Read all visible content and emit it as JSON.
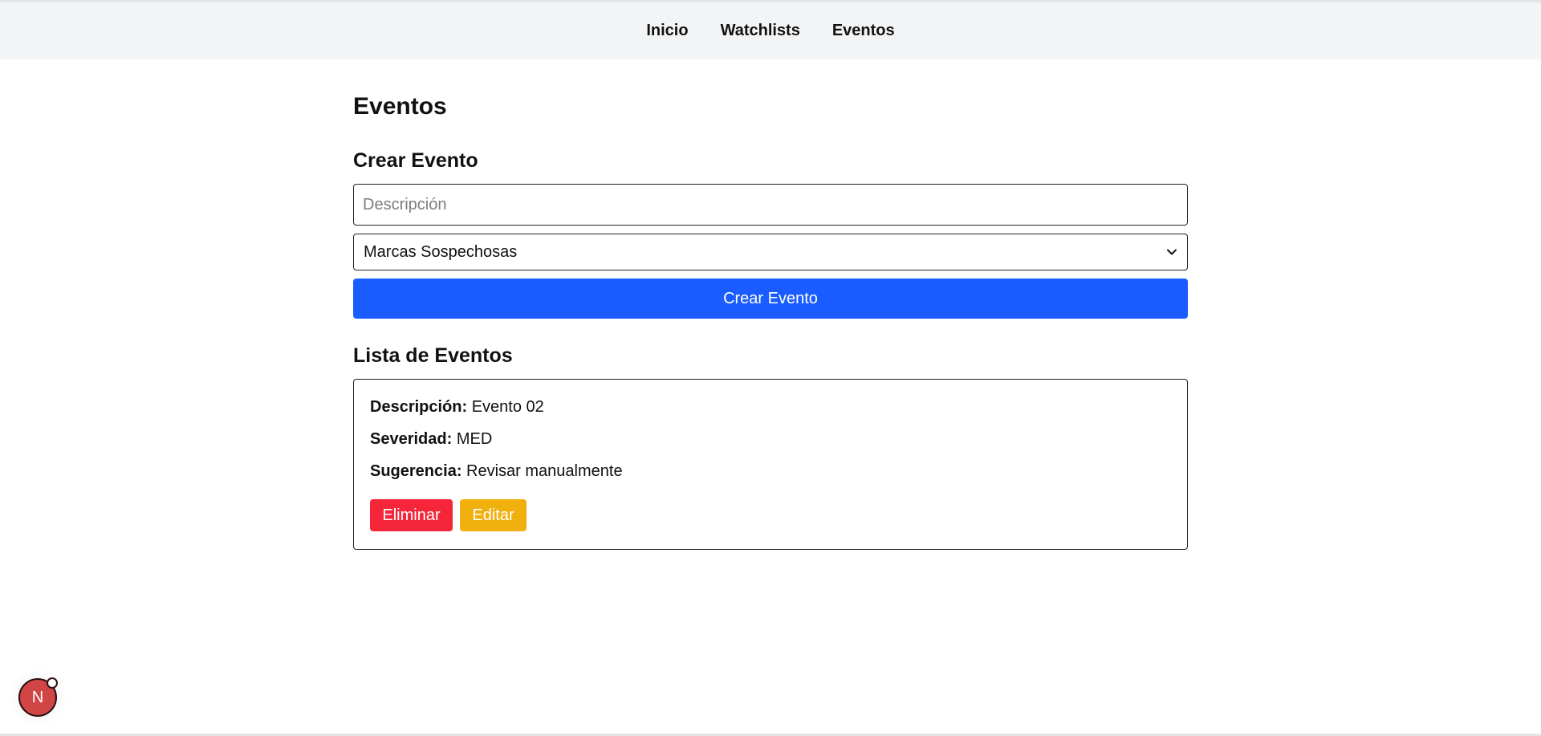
{
  "nav": {
    "items": [
      {
        "label": "Inicio"
      },
      {
        "label": "Watchlists"
      },
      {
        "label": "Eventos"
      }
    ]
  },
  "page": {
    "title": "Eventos"
  },
  "create": {
    "title": "Crear Evento",
    "description_placeholder": "Descripción",
    "description_value": "",
    "type_select": {
      "selected": "Marcas Sospechosas"
    },
    "submit_label": "Crear Evento"
  },
  "list": {
    "title": "Lista de Eventos",
    "events": [
      {
        "description_label": "Descripción:",
        "description": "Evento 02",
        "severity_label": "Severidad:",
        "severity": "MED",
        "suggestion_label": "Sugerencia:",
        "suggestion": "Revisar manualmente",
        "delete_label": "Eliminar",
        "edit_label": "Editar"
      }
    ]
  },
  "badge": {
    "letter": "N"
  },
  "colors": {
    "primary": "#1a5cff",
    "danger": "#f5263a",
    "warning": "#f0b00e",
    "navbar_bg": "#f3f4f6",
    "badge_bg": "#d24545"
  },
  "icons": {
    "select": "chevron-down-icon"
  }
}
